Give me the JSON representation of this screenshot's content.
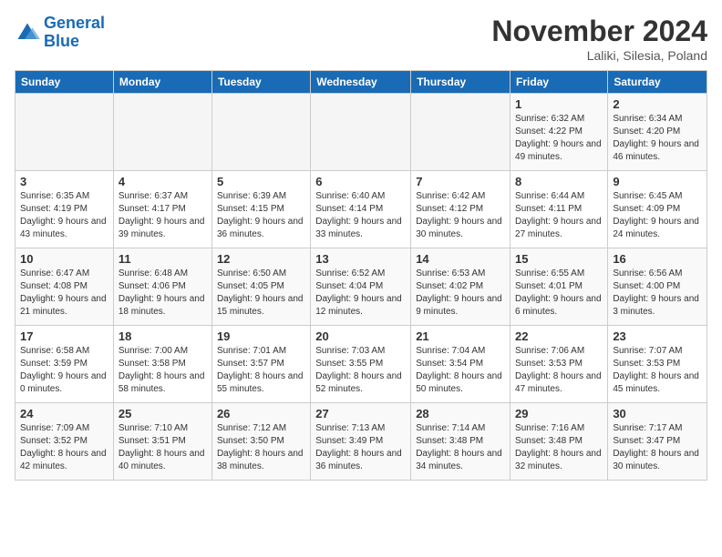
{
  "logo": {
    "name_general": "General",
    "name_blue": "Blue"
  },
  "header": {
    "month": "November 2024",
    "location": "Laliki, Silesia, Poland"
  },
  "weekdays": [
    "Sunday",
    "Monday",
    "Tuesday",
    "Wednesday",
    "Thursday",
    "Friday",
    "Saturday"
  ],
  "weeks": [
    [
      {
        "day": "",
        "info": ""
      },
      {
        "day": "",
        "info": ""
      },
      {
        "day": "",
        "info": ""
      },
      {
        "day": "",
        "info": ""
      },
      {
        "day": "",
        "info": ""
      },
      {
        "day": "1",
        "info": "Sunrise: 6:32 AM\nSunset: 4:22 PM\nDaylight: 9 hours and 49 minutes."
      },
      {
        "day": "2",
        "info": "Sunrise: 6:34 AM\nSunset: 4:20 PM\nDaylight: 9 hours and 46 minutes."
      }
    ],
    [
      {
        "day": "3",
        "info": "Sunrise: 6:35 AM\nSunset: 4:19 PM\nDaylight: 9 hours and 43 minutes."
      },
      {
        "day": "4",
        "info": "Sunrise: 6:37 AM\nSunset: 4:17 PM\nDaylight: 9 hours and 39 minutes."
      },
      {
        "day": "5",
        "info": "Sunrise: 6:39 AM\nSunset: 4:15 PM\nDaylight: 9 hours and 36 minutes."
      },
      {
        "day": "6",
        "info": "Sunrise: 6:40 AM\nSunset: 4:14 PM\nDaylight: 9 hours and 33 minutes."
      },
      {
        "day": "7",
        "info": "Sunrise: 6:42 AM\nSunset: 4:12 PM\nDaylight: 9 hours and 30 minutes."
      },
      {
        "day": "8",
        "info": "Sunrise: 6:44 AM\nSunset: 4:11 PM\nDaylight: 9 hours and 27 minutes."
      },
      {
        "day": "9",
        "info": "Sunrise: 6:45 AM\nSunset: 4:09 PM\nDaylight: 9 hours and 24 minutes."
      }
    ],
    [
      {
        "day": "10",
        "info": "Sunrise: 6:47 AM\nSunset: 4:08 PM\nDaylight: 9 hours and 21 minutes."
      },
      {
        "day": "11",
        "info": "Sunrise: 6:48 AM\nSunset: 4:06 PM\nDaylight: 9 hours and 18 minutes."
      },
      {
        "day": "12",
        "info": "Sunrise: 6:50 AM\nSunset: 4:05 PM\nDaylight: 9 hours and 15 minutes."
      },
      {
        "day": "13",
        "info": "Sunrise: 6:52 AM\nSunset: 4:04 PM\nDaylight: 9 hours and 12 minutes."
      },
      {
        "day": "14",
        "info": "Sunrise: 6:53 AM\nSunset: 4:02 PM\nDaylight: 9 hours and 9 minutes."
      },
      {
        "day": "15",
        "info": "Sunrise: 6:55 AM\nSunset: 4:01 PM\nDaylight: 9 hours and 6 minutes."
      },
      {
        "day": "16",
        "info": "Sunrise: 6:56 AM\nSunset: 4:00 PM\nDaylight: 9 hours and 3 minutes."
      }
    ],
    [
      {
        "day": "17",
        "info": "Sunrise: 6:58 AM\nSunset: 3:59 PM\nDaylight: 9 hours and 0 minutes."
      },
      {
        "day": "18",
        "info": "Sunrise: 7:00 AM\nSunset: 3:58 PM\nDaylight: 8 hours and 58 minutes."
      },
      {
        "day": "19",
        "info": "Sunrise: 7:01 AM\nSunset: 3:57 PM\nDaylight: 8 hours and 55 minutes."
      },
      {
        "day": "20",
        "info": "Sunrise: 7:03 AM\nSunset: 3:55 PM\nDaylight: 8 hours and 52 minutes."
      },
      {
        "day": "21",
        "info": "Sunrise: 7:04 AM\nSunset: 3:54 PM\nDaylight: 8 hours and 50 minutes."
      },
      {
        "day": "22",
        "info": "Sunrise: 7:06 AM\nSunset: 3:53 PM\nDaylight: 8 hours and 47 minutes."
      },
      {
        "day": "23",
        "info": "Sunrise: 7:07 AM\nSunset: 3:53 PM\nDaylight: 8 hours and 45 minutes."
      }
    ],
    [
      {
        "day": "24",
        "info": "Sunrise: 7:09 AM\nSunset: 3:52 PM\nDaylight: 8 hours and 42 minutes."
      },
      {
        "day": "25",
        "info": "Sunrise: 7:10 AM\nSunset: 3:51 PM\nDaylight: 8 hours and 40 minutes."
      },
      {
        "day": "26",
        "info": "Sunrise: 7:12 AM\nSunset: 3:50 PM\nDaylight: 8 hours and 38 minutes."
      },
      {
        "day": "27",
        "info": "Sunrise: 7:13 AM\nSunset: 3:49 PM\nDaylight: 8 hours and 36 minutes."
      },
      {
        "day": "28",
        "info": "Sunrise: 7:14 AM\nSunset: 3:48 PM\nDaylight: 8 hours and 34 minutes."
      },
      {
        "day": "29",
        "info": "Sunrise: 7:16 AM\nSunset: 3:48 PM\nDaylight: 8 hours and 32 minutes."
      },
      {
        "day": "30",
        "info": "Sunrise: 7:17 AM\nSunset: 3:47 PM\nDaylight: 8 hours and 30 minutes."
      }
    ]
  ]
}
